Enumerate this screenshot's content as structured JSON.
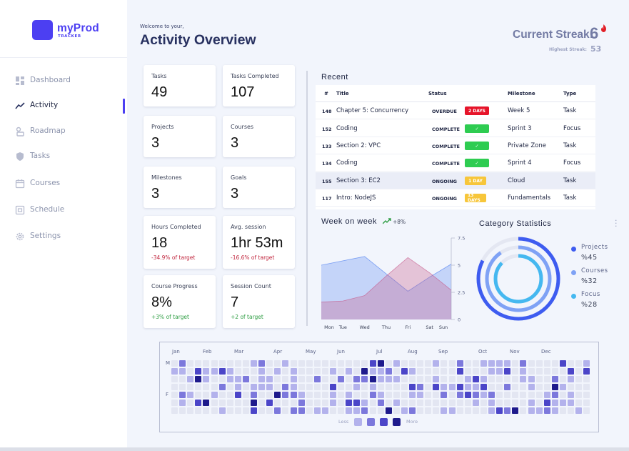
{
  "app": {
    "logo_name": "myProd",
    "logo_sub": "TRACKER",
    "accent": "#4c3ff2"
  },
  "sidebar": {
    "items": [
      {
        "label": "Dashboard",
        "icon": "dashboard-icon",
        "active": false
      },
      {
        "label": "Activity",
        "icon": "activity-icon",
        "active": true
      },
      {
        "label": "Roadmap",
        "icon": "roadmap-icon",
        "active": false
      },
      {
        "label": "Tasks",
        "icon": "shield-icon",
        "active": false
      },
      {
        "label": "Courses",
        "icon": "calendar-icon",
        "active": false
      },
      {
        "label": "Schedule",
        "icon": "schedule-icon",
        "active": false
      },
      {
        "label": "Settings",
        "icon": "gear-icon",
        "active": false
      }
    ]
  },
  "header": {
    "welcome": "Welcome to your,",
    "title": "Activity Overview",
    "streak_label": "Current Streak:",
    "streak_value": "6",
    "highest_label": "Highest Streak:",
    "highest_value": "53"
  },
  "cards": [
    {
      "label": "Tasks",
      "value": "49",
      "sub": "",
      "sub_type": ""
    },
    {
      "label": "Tasks Completed",
      "value": "107",
      "sub": "",
      "sub_type": ""
    },
    {
      "label": "Projects",
      "value": "3",
      "sub": "",
      "sub_type": ""
    },
    {
      "label": "Courses",
      "value": "3",
      "sub": "",
      "sub_type": ""
    },
    {
      "label": "Milestones",
      "value": "3",
      "sub": "",
      "sub_type": ""
    },
    {
      "label": "Goals",
      "value": "3",
      "sub": "",
      "sub_type": ""
    },
    {
      "label": "Hours Completed",
      "value": "18",
      "sub": "-34.9% of target",
      "sub_type": "neg"
    },
    {
      "label": "Avg. session",
      "value": "1hr 53m",
      "sub": "-16.6% of target",
      "sub_type": "neg"
    },
    {
      "label": "Course Progress",
      "value": "8%",
      "sub": "+3% of target",
      "sub_type": "pos"
    },
    {
      "label": "Session Count",
      "value": "7",
      "sub": "+2 of target",
      "sub_type": "pos"
    }
  ],
  "recent": {
    "title": "Recent",
    "columns": [
      "#",
      "Title",
      "Status",
      "Milestone",
      "Type"
    ],
    "rows": [
      {
        "num": "148",
        "title": "Chapter 5: Concurrency",
        "status": "OVERDUE",
        "badge": "2 DAYS",
        "badge_type": "red",
        "milestone": "Week 5",
        "type": "Task"
      },
      {
        "num": "152",
        "title": "Coding",
        "status": "COMPLETE",
        "badge": "✓",
        "badge_type": "green",
        "milestone": "Sprint 3",
        "type": "Focus"
      },
      {
        "num": "133",
        "title": "Section 2: VPC",
        "status": "COMPLETE",
        "badge": "✓",
        "badge_type": "green",
        "milestone": "Private Zone",
        "type": "Task"
      },
      {
        "num": "134",
        "title": "Coding",
        "status": "COMPLETE",
        "badge": "✓",
        "badge_type": "green",
        "milestone": "Sprint 4",
        "type": "Focus"
      },
      {
        "num": "155",
        "title": "Section 3: EC2",
        "status": "ONGOING",
        "badge": "1 DAY",
        "badge_type": "yellow",
        "milestone": "Cloud",
        "type": "Task"
      },
      {
        "num": "117",
        "title": "Intro: NodeJS",
        "status": "ONGOING",
        "badge": "13 DAYS",
        "badge_type": "yellow",
        "milestone": "Fundamentals",
        "type": "Task"
      }
    ]
  },
  "week_on_week": {
    "title": "Week on week",
    "trend": "+8%"
  },
  "category": {
    "title": "Category Statistics",
    "items": [
      {
        "name": "Projects",
        "value": "%45",
        "color": "#3e5cf0"
      },
      {
        "name": "Courses",
        "value": "%32",
        "color": "#7fa2f5"
      },
      {
        "name": "Focus",
        "value": "%28",
        "color": "#45b8f0"
      }
    ]
  },
  "chart_data": {
    "type": "area",
    "categories": [
      "Mon",
      "Tue",
      "Wed",
      "Thu",
      "Fri",
      "Sat",
      "Sun"
    ],
    "ylim": [
      0,
      7.5
    ],
    "yticks": [
      "7.5",
      "5",
      "2.5",
      "0"
    ],
    "series": [
      {
        "values": [
          5.0,
          5.4,
          5.8,
          4.2,
          2.6,
          3.9,
          5.1
        ],
        "color": "#4f7ff0"
      },
      {
        "values": [
          1.6,
          1.7,
          2.2,
          4.0,
          5.7,
          4.3,
          2.7
        ],
        "color": "#c65a8a"
      }
    ]
  },
  "heatmap": {
    "months": [
      "Jan",
      "Feb",
      "Mar",
      "Apr",
      "May",
      "Jun",
      "Jul",
      "Aug",
      "Sep",
      "Oct",
      "Nov",
      "Dec"
    ],
    "day_labels": [
      "M",
      "F"
    ],
    "legend_less": "Less",
    "legend_more": "More",
    "colors": [
      "#e3e6f2",
      "#b3b2ec",
      "#7c78dc",
      "#4b45c8",
      "#1e1a8c"
    ]
  }
}
